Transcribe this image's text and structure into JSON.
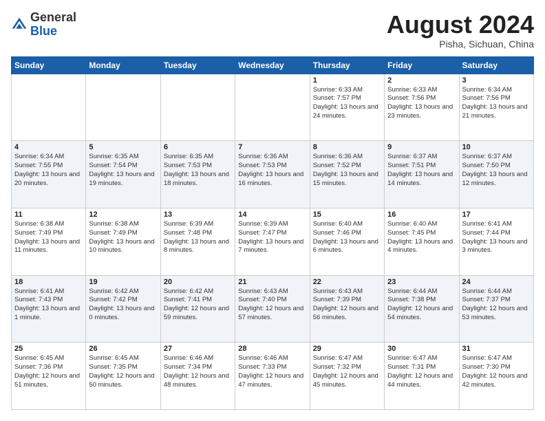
{
  "header": {
    "logo_general": "General",
    "logo_blue": "Blue",
    "month_year": "August 2024",
    "location": "Pisha, Sichuan, China"
  },
  "weekdays": [
    "Sunday",
    "Monday",
    "Tuesday",
    "Wednesday",
    "Thursday",
    "Friday",
    "Saturday"
  ],
  "weeks": [
    [
      {
        "day": "",
        "info": ""
      },
      {
        "day": "",
        "info": ""
      },
      {
        "day": "",
        "info": ""
      },
      {
        "day": "",
        "info": ""
      },
      {
        "day": "1",
        "info": "Sunrise: 6:33 AM\nSunset: 7:57 PM\nDaylight: 13 hours and 24 minutes."
      },
      {
        "day": "2",
        "info": "Sunrise: 6:33 AM\nSunset: 7:56 PM\nDaylight: 13 hours and 23 minutes."
      },
      {
        "day": "3",
        "info": "Sunrise: 6:34 AM\nSunset: 7:56 PM\nDaylight: 13 hours and 21 minutes."
      }
    ],
    [
      {
        "day": "4",
        "info": "Sunrise: 6:34 AM\nSunset: 7:55 PM\nDaylight: 13 hours and 20 minutes."
      },
      {
        "day": "5",
        "info": "Sunrise: 6:35 AM\nSunset: 7:54 PM\nDaylight: 13 hours and 19 minutes."
      },
      {
        "day": "6",
        "info": "Sunrise: 6:35 AM\nSunset: 7:53 PM\nDaylight: 13 hours and 18 minutes."
      },
      {
        "day": "7",
        "info": "Sunrise: 6:36 AM\nSunset: 7:53 PM\nDaylight: 13 hours and 16 minutes."
      },
      {
        "day": "8",
        "info": "Sunrise: 6:36 AM\nSunset: 7:52 PM\nDaylight: 13 hours and 15 minutes."
      },
      {
        "day": "9",
        "info": "Sunrise: 6:37 AM\nSunset: 7:51 PM\nDaylight: 13 hours and 14 minutes."
      },
      {
        "day": "10",
        "info": "Sunrise: 6:37 AM\nSunset: 7:50 PM\nDaylight: 13 hours and 12 minutes."
      }
    ],
    [
      {
        "day": "11",
        "info": "Sunrise: 6:38 AM\nSunset: 7:49 PM\nDaylight: 13 hours and 11 minutes."
      },
      {
        "day": "12",
        "info": "Sunrise: 6:38 AM\nSunset: 7:49 PM\nDaylight: 13 hours and 10 minutes."
      },
      {
        "day": "13",
        "info": "Sunrise: 6:39 AM\nSunset: 7:48 PM\nDaylight: 13 hours and 8 minutes."
      },
      {
        "day": "14",
        "info": "Sunrise: 6:39 AM\nSunset: 7:47 PM\nDaylight: 13 hours and 7 minutes."
      },
      {
        "day": "15",
        "info": "Sunrise: 6:40 AM\nSunset: 7:46 PM\nDaylight: 13 hours and 6 minutes."
      },
      {
        "day": "16",
        "info": "Sunrise: 6:40 AM\nSunset: 7:45 PM\nDaylight: 13 hours and 4 minutes."
      },
      {
        "day": "17",
        "info": "Sunrise: 6:41 AM\nSunset: 7:44 PM\nDaylight: 13 hours and 3 minutes."
      }
    ],
    [
      {
        "day": "18",
        "info": "Sunrise: 6:41 AM\nSunset: 7:43 PM\nDaylight: 13 hours and 1 minute."
      },
      {
        "day": "19",
        "info": "Sunrise: 6:42 AM\nSunset: 7:42 PM\nDaylight: 13 hours and 0 minutes."
      },
      {
        "day": "20",
        "info": "Sunrise: 6:42 AM\nSunset: 7:41 PM\nDaylight: 12 hours and 59 minutes."
      },
      {
        "day": "21",
        "info": "Sunrise: 6:43 AM\nSunset: 7:40 PM\nDaylight: 12 hours and 57 minutes."
      },
      {
        "day": "22",
        "info": "Sunrise: 6:43 AM\nSunset: 7:39 PM\nDaylight: 12 hours and 56 minutes."
      },
      {
        "day": "23",
        "info": "Sunrise: 6:44 AM\nSunset: 7:38 PM\nDaylight: 12 hours and 54 minutes."
      },
      {
        "day": "24",
        "info": "Sunrise: 6:44 AM\nSunset: 7:37 PM\nDaylight: 12 hours and 53 minutes."
      }
    ],
    [
      {
        "day": "25",
        "info": "Sunrise: 6:45 AM\nSunset: 7:36 PM\nDaylight: 12 hours and 51 minutes."
      },
      {
        "day": "26",
        "info": "Sunrise: 6:45 AM\nSunset: 7:35 PM\nDaylight: 12 hours and 50 minutes."
      },
      {
        "day": "27",
        "info": "Sunrise: 6:46 AM\nSunset: 7:34 PM\nDaylight: 12 hours and 48 minutes."
      },
      {
        "day": "28",
        "info": "Sunrise: 6:46 AM\nSunset: 7:33 PM\nDaylight: 12 hours and 47 minutes."
      },
      {
        "day": "29",
        "info": "Sunrise: 6:47 AM\nSunset: 7:32 PM\nDaylight: 12 hours and 45 minutes."
      },
      {
        "day": "30",
        "info": "Sunrise: 6:47 AM\nSunset: 7:31 PM\nDaylight: 12 hours and 44 minutes."
      },
      {
        "day": "31",
        "info": "Sunrise: 6:47 AM\nSunset: 7:30 PM\nDaylight: 12 hours and 42 minutes."
      }
    ]
  ]
}
